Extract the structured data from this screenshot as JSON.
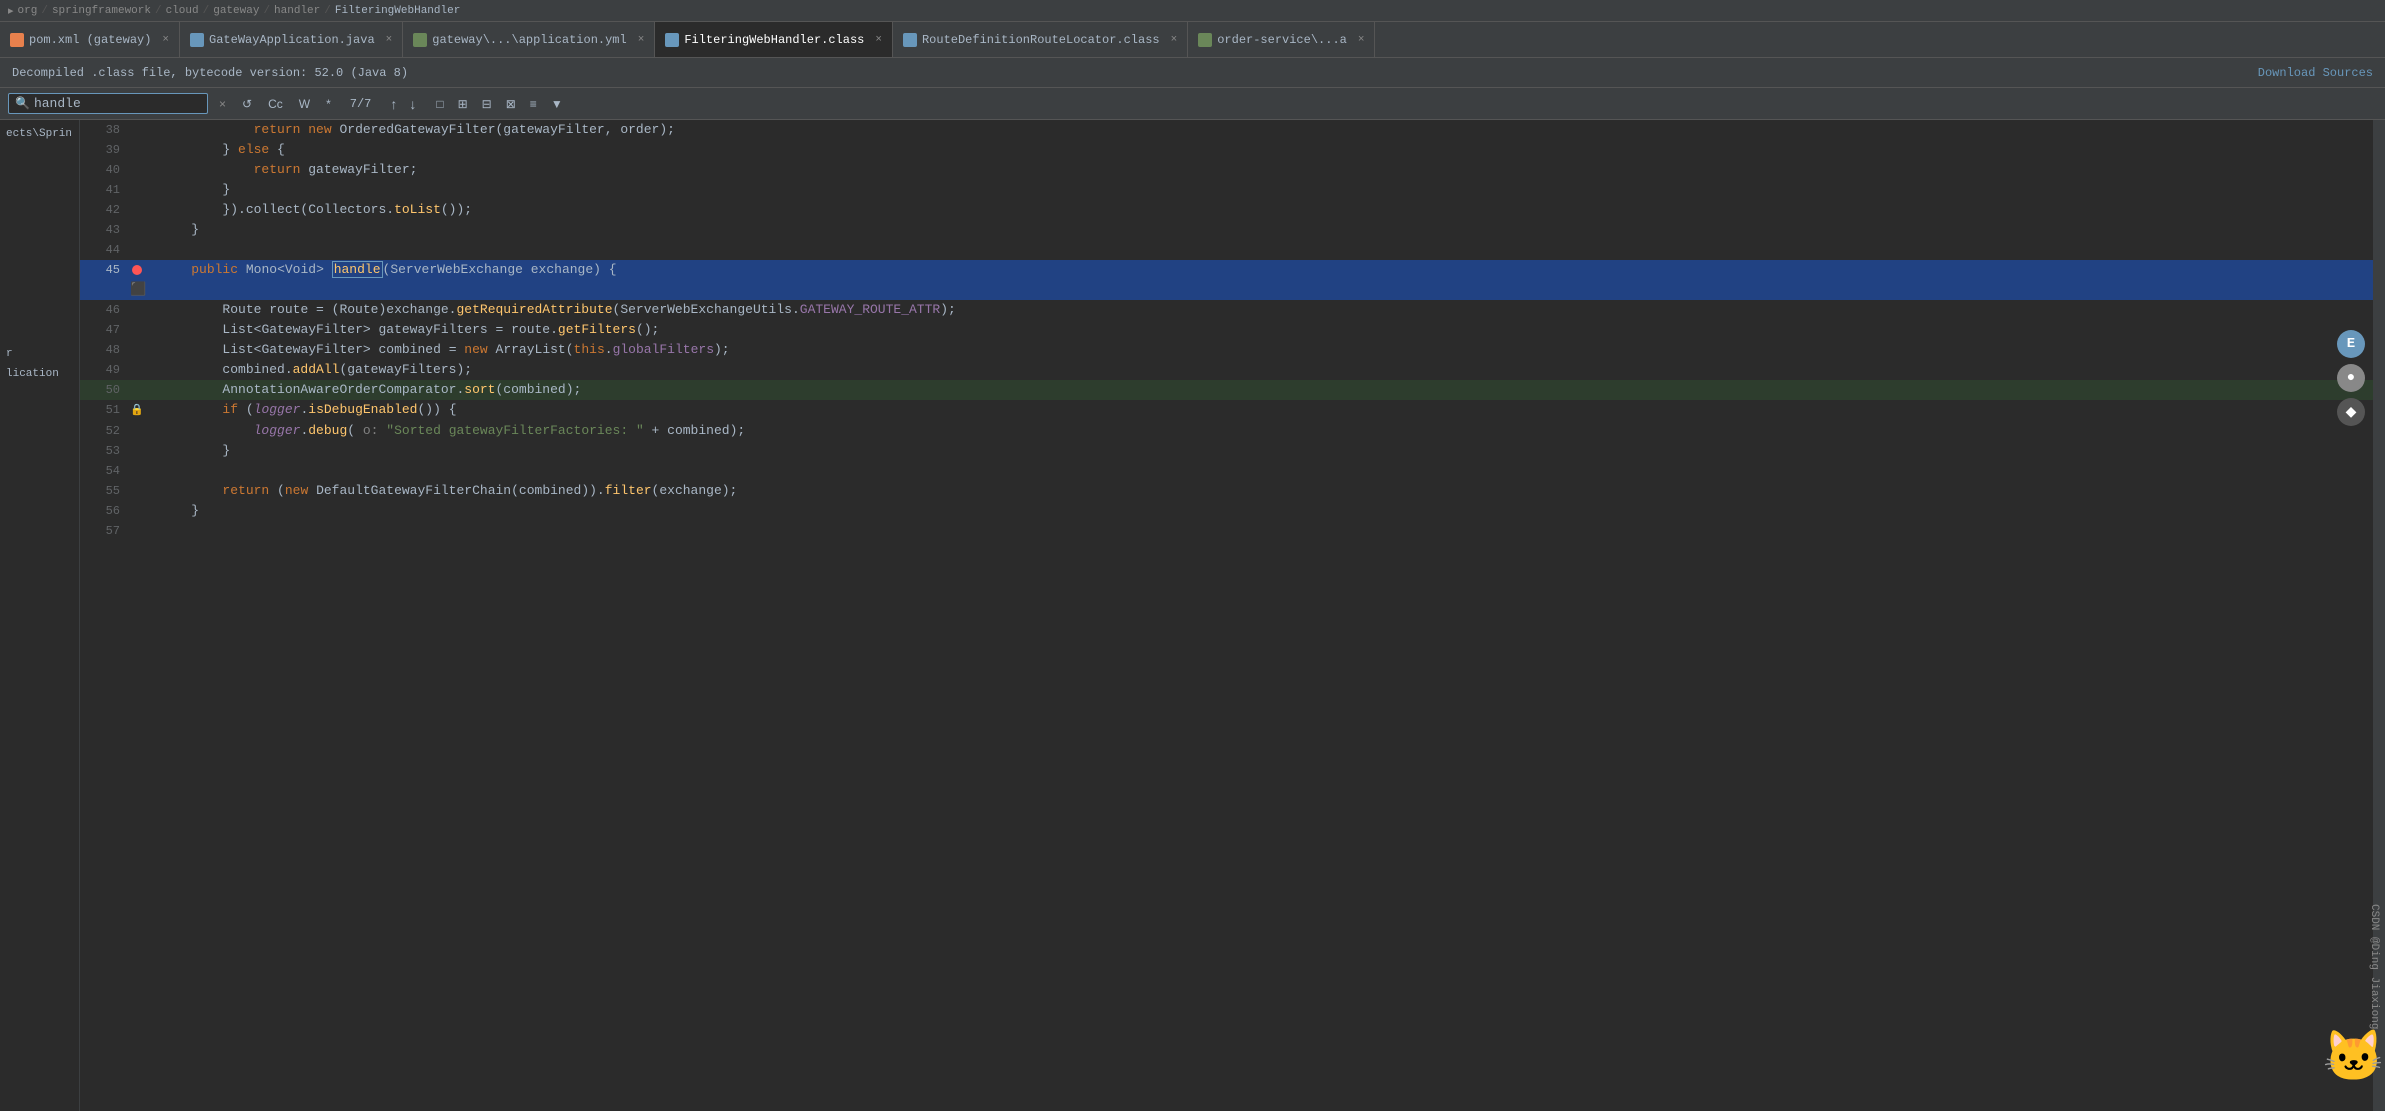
{
  "breadcrumb": {
    "items": [
      "org",
      "springframework",
      "cloud",
      "gateway",
      "handler",
      "FilteringWebHandler"
    ]
  },
  "tabs": [
    {
      "id": "pom",
      "label": "pom.xml (gateway)",
      "icon_color": "#e8814d",
      "active": false
    },
    {
      "id": "gateway",
      "label": "GateWayApplication.java",
      "icon_color": "#6897bb",
      "active": false
    },
    {
      "id": "yaml",
      "label": "gateway\\...\\application.yml",
      "icon_color": "#6a8759",
      "active": false
    },
    {
      "id": "filtering",
      "label": "FilteringWebHandler.class",
      "icon_color": "#6897bb",
      "active": true
    },
    {
      "id": "route",
      "label": "RouteDefinitionRouteLocator.class",
      "icon_color": "#6897bb",
      "active": false
    },
    {
      "id": "order",
      "label": "order-service\\...a",
      "icon_color": "#6a8759",
      "active": false
    }
  ],
  "info_bar": {
    "message": "Decompiled .class file, bytecode version: 52.0 (Java 8)",
    "download_label": "Download Sources"
  },
  "search": {
    "query": "handle",
    "count": "7/7",
    "placeholder": "handle"
  },
  "sidebar": {
    "items": [
      "ects\\Sprin",
      "r",
      "lication"
    ]
  },
  "code_lines": [
    {
      "num": 38,
      "content": "            return new OrderedGatewayFilter(gatewayFilter, order);",
      "gutter": ""
    },
    {
      "num": 39,
      "content": "        } else {",
      "gutter": ""
    },
    {
      "num": 40,
      "content": "            return gatewayFilter;",
      "gutter": ""
    },
    {
      "num": 41,
      "content": "        }",
      "gutter": ""
    },
    {
      "num": 42,
      "content": "        }).collect(Collectors.toList());",
      "gutter": ""
    },
    {
      "num": 43,
      "content": "    }",
      "gutter": ""
    },
    {
      "num": 44,
      "content": "",
      "gutter": ""
    },
    {
      "num": 45,
      "content": "    public Mono<Void> handle(ServerWebExchange exchange) {",
      "gutter": "bp",
      "highlighted": true
    },
    {
      "num": 46,
      "content": "        Route route = (Route)exchange.getRequiredAttribute(ServerWebExchangeUtils.GATEWAY_ROUTE_ATTR);",
      "gutter": ""
    },
    {
      "num": 47,
      "content": "        List<GatewayFilter> gatewayFilters = route.getFilters();",
      "gutter": ""
    },
    {
      "num": 48,
      "content": "        List<GatewayFilter> combined = new ArrayList(this.globalFilters);",
      "gutter": ""
    },
    {
      "num": 49,
      "content": "        combined.addAll(gatewayFilters);",
      "gutter": ""
    },
    {
      "num": 50,
      "content": "        AnnotationAwareOrderComparator.sort(combined);",
      "gutter": "",
      "soft_highlight": true
    },
    {
      "num": 51,
      "content": "        if (logger.isDebugEnabled()) {",
      "gutter": ""
    },
    {
      "num": 52,
      "content": "            logger.debug( o: \"Sorted gatewayFilterFactories: \" + combined);",
      "gutter": ""
    },
    {
      "num": 53,
      "content": "        }",
      "gutter": ""
    },
    {
      "num": 54,
      "content": "",
      "gutter": ""
    },
    {
      "num": 55,
      "content": "        return (new DefaultGatewayFilterChain(combined)).filter(exchange);",
      "gutter": ""
    },
    {
      "num": 56,
      "content": "    }",
      "gutter": ""
    },
    {
      "num": 57,
      "content": "",
      "gutter": ""
    }
  ],
  "toolbar": {
    "buttons": [
      "×",
      "↺",
      "Cc",
      "W",
      "*",
      "↑",
      "↓",
      "□",
      "⊕",
      "⊖",
      "⊗",
      "≡",
      "▼"
    ]
  },
  "corner": {
    "label": "CSDN @Ding Jiaxiong",
    "emoji": "🐱"
  },
  "float_buttons": [
    {
      "label": "E",
      "style": "e"
    },
    {
      "label": "●",
      "style": "o"
    },
    {
      "label": "◆",
      "style": "s"
    }
  ]
}
